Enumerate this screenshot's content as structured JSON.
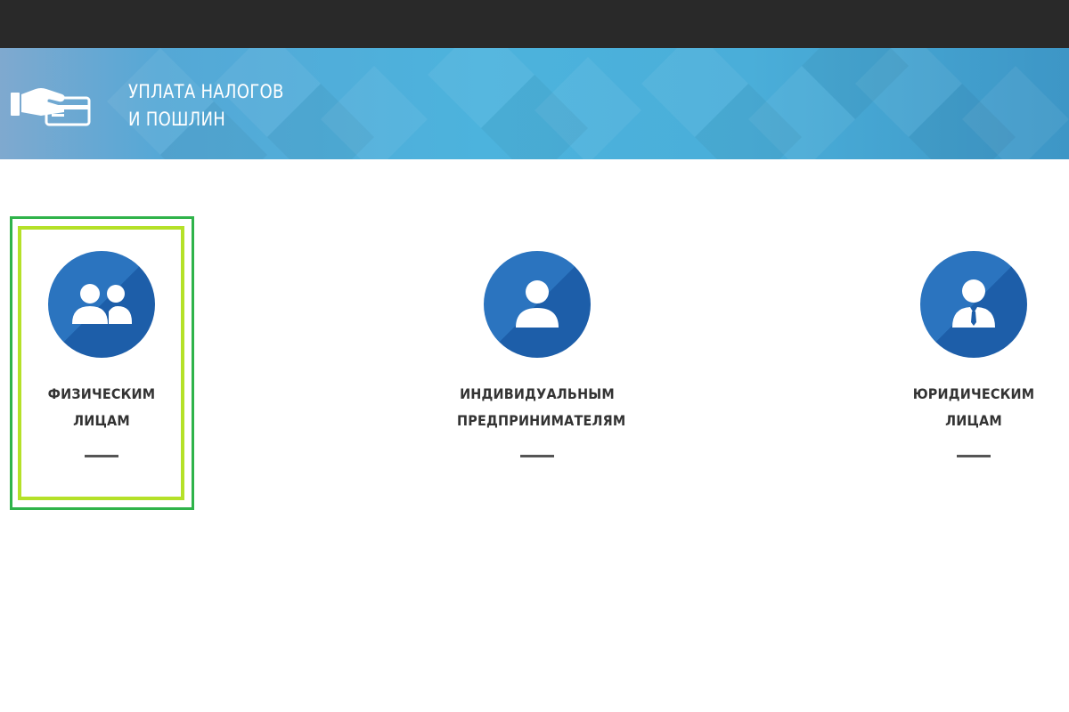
{
  "header": {
    "title_line1": "УПЛАТА НАЛОГОВ",
    "title_line2": "И ПОШЛИН",
    "icon": "hand-card-icon"
  },
  "cards": [
    {
      "line1": "ФИЗИЧЕСКИМ",
      "line2": "ЛИЦАМ",
      "icon": "two-people-icon",
      "selected": true
    },
    {
      "line1": "ИНДИВИДУАЛЬНЫМ",
      "line2": "ПРЕДПРИНИМАТЕЛЯМ",
      "icon": "person-icon",
      "selected": false
    },
    {
      "line1": "ЮРИДИЧЕСКИМ",
      "line2": "ЛИЦАМ",
      "icon": "businessman-icon",
      "selected": false
    }
  ],
  "colors": {
    "topbar": "#292929",
    "banner": "#4cb3dd",
    "circle": "#2b74bf",
    "focus_outer": "#2fb34a",
    "focus_inner": "#b5e128",
    "label": "#333333"
  }
}
